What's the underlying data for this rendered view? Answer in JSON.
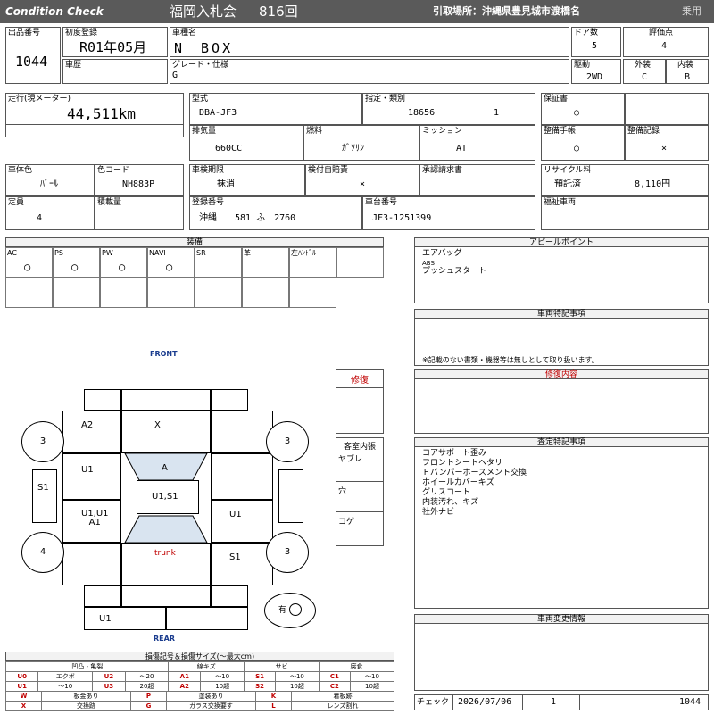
{
  "header": {
    "brand": "Condition Check",
    "auction": "福岡入札会",
    "lot_no": "816回",
    "pickup": "引取場所：沖縄県豊見城市渡橋名",
    "category": "乗用"
  },
  "vehicle": {
    "lot_label": "出品番号",
    "lot_value": "1044",
    "first_reg_label": "初度登録",
    "first_reg_value": "R01年05月",
    "name_label": "車種名",
    "name_value": "N　BOX",
    "doors_label": "ドア数",
    "doors_value": "5",
    "score_label": "評価点",
    "score_value": "4",
    "history_label": "車歴",
    "grade_label": "グレード・仕様",
    "grade_value": "G",
    "drive_label": "駆動",
    "drive_value": "2WD",
    "exterior_label": "外装",
    "exterior_value": "C",
    "interior_label": "内装",
    "interior_value": "B",
    "mileage_label": "走行(現メーター)",
    "mileage_value": "44,511km",
    "model_label": "型式",
    "model_value": "DBA-JF3",
    "designation_label": "指定・類別",
    "designation_value": "18656",
    "class_value": "1",
    "warranty_label": "保証書",
    "warranty_value": "○",
    "displacement_label": "排気量",
    "displacement_value": "660CC",
    "fuel_label": "燃料",
    "fuel_value": "ｶﾞｿﾘﾝ",
    "mission_label": "ミッション",
    "mission_value": "AT",
    "manual_label": "整備手帳",
    "manual_value": "○",
    "record_label": "整備記録",
    "record_value": "×",
    "color_label": "車体色",
    "color_value": "ﾊﾟｰﾙ",
    "color_code_label": "色コード",
    "color_code_value": "NH883P",
    "inspection_label": "車検期限",
    "inspection_value": "抹消",
    "insurance_label": "検付自賠責",
    "insurance_value": "×",
    "approval_label": "承認請求書",
    "recycle_label": "リサイクル料",
    "recycle_status": "預託済",
    "recycle_value": "8,110円",
    "capacity_label": "定員",
    "capacity_value": "4",
    "load_label": "積載量",
    "plate_label": "登録番号",
    "plate_value": "沖縄　　581 ふ　2760",
    "chassis_label": "車台番号",
    "chassis_value": "JF3-1251399",
    "welfare_label": "福祉車両"
  },
  "equipment": {
    "title": "装備",
    "items": [
      {
        "label": "AC",
        "mark": "○"
      },
      {
        "label": "PS",
        "mark": "○"
      },
      {
        "label": "PW",
        "mark": "○"
      },
      {
        "label": "NAVI",
        "mark": "○"
      },
      {
        "label": "SR",
        "mark": ""
      },
      {
        "label": "革",
        "mark": ""
      },
      {
        "label": "左ﾊﾝﾄﾞﾙ",
        "mark": ""
      }
    ]
  },
  "appeal": {
    "title": "アピールポイント",
    "lines": [
      "エアバッグ",
      "ABS",
      "プッシュスタート"
    ]
  },
  "special": {
    "title": "車両特記事項",
    "note": "※記載のない書類・機器等は無しとして取り扱います。"
  },
  "repair": {
    "title": "修復内容"
  },
  "assessment": {
    "title": "査定特記事項",
    "lines": [
      "コアサポート歪み",
      "フロントシートヘタリ",
      "Ｆバンパーホースメント交換",
      "ホイールカバーキズ",
      "グリスコート",
      "内装汚れ、キズ",
      "社外ナビ"
    ]
  },
  "change": {
    "title": "車両変更情報"
  },
  "diagram": {
    "front": "FRONT",
    "rear": "REAR",
    "trunk": "trunk",
    "repair_label": "修復",
    "cabin_label": "客室内張",
    "cabin_items": [
      "ヤブレ",
      "穴",
      "コゲ"
    ],
    "spare_label": "有",
    "panels": {
      "a2": "A2",
      "x": "X",
      "u1_left_front": "U1",
      "a_windshield": "A",
      "roof": "U1,S1",
      "u1a1": "U1,U1\nA1",
      "u1_right": "U1",
      "s1_rear": "S1",
      "u1_rear": "U1",
      "s1_left": "S1"
    },
    "tires": {
      "front_left": "3",
      "front_right": "3",
      "rear_left": "4",
      "rear_right": "3"
    }
  },
  "legend": {
    "title": "損傷記号＆損傷サイズ(～最大cm)",
    "headers": [
      "凹凸・亀裂",
      "線キズ",
      "サビ",
      "腐食"
    ],
    "row1": [
      "U0",
      "エクボ",
      "U2",
      "～20",
      "A1",
      "～10",
      "S1",
      "～10",
      "C1",
      "～10"
    ],
    "row2": [
      "U1",
      "～10",
      "U3",
      "20超",
      "A2",
      "10超",
      "S2",
      "10超",
      "C2",
      "10超"
    ],
    "row3": [
      "W",
      "板金あり",
      "P",
      "塗装あり",
      "K",
      "着板跡"
    ],
    "row4": [
      "X",
      "交換跡",
      "G",
      "ガラス交換要す",
      "L",
      "レンズ割れ"
    ]
  },
  "footer": {
    "check_label": "チェック",
    "date": "2026/07/06",
    "count": "1",
    "lot": "1044"
  }
}
